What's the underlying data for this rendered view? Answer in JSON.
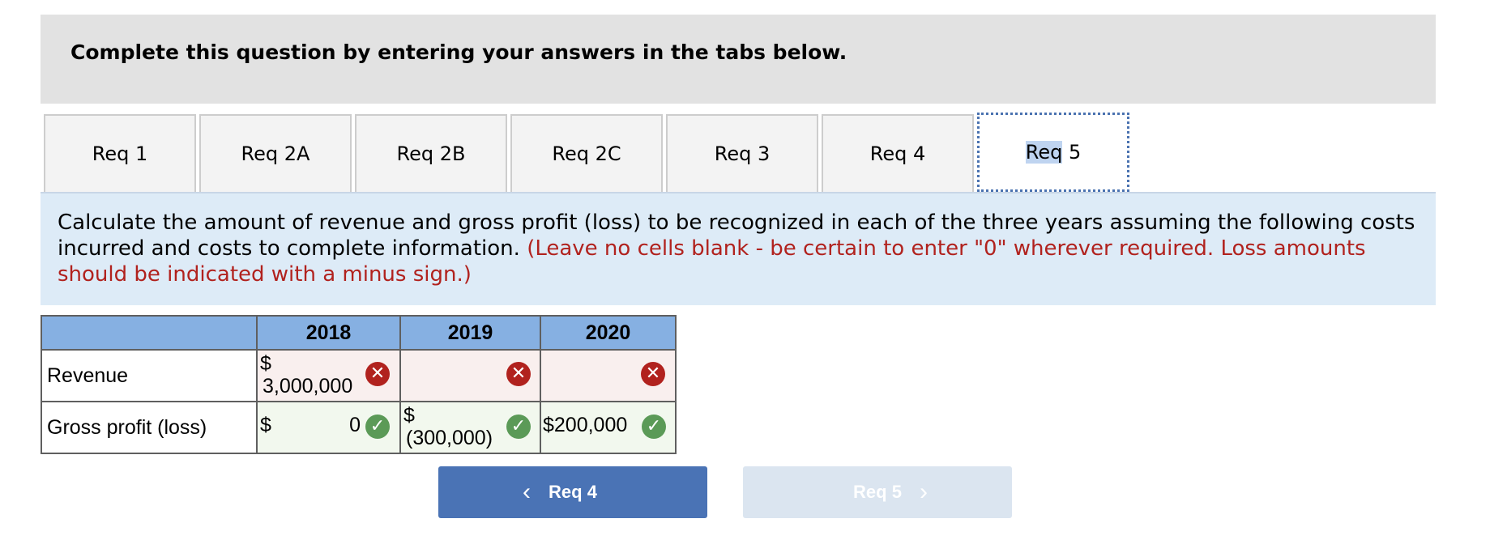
{
  "header": {
    "title": "Complete this question by entering your answers in the tabs below."
  },
  "tabs": [
    {
      "label": "Req 1"
    },
    {
      "label": "Req 2A"
    },
    {
      "label": "Req 2B"
    },
    {
      "label": "Req 2C"
    },
    {
      "label": "Req 3"
    },
    {
      "label": "Req 4"
    },
    {
      "label_selected": "Req",
      "label_rest": " 5"
    }
  ],
  "instructions": {
    "text": "Calculate the amount of revenue and gross profit (loss) to be recognized in each of the three years assuming the following costs incurred and costs to complete information.",
    "note": "(Leave no cells blank - be certain to enter \"0\" wherever required. Loss amounts should be indicated with a minus sign.)"
  },
  "table": {
    "columns": [
      "2018",
      "2019",
      "2020"
    ],
    "rows": [
      {
        "label": "Revenue",
        "cells": [
          {
            "prefix": "$",
            "value": "3,000,000",
            "status": "incorrect"
          },
          {
            "prefix": "",
            "value": "",
            "status": "incorrect"
          },
          {
            "prefix": "",
            "value": "",
            "status": "incorrect"
          }
        ]
      },
      {
        "label": "Gross profit (loss)",
        "cells": [
          {
            "prefix": "$",
            "value": "0",
            "status": "correct"
          },
          {
            "prefix": "$",
            "value": "(300,000)",
            "status": "correct"
          },
          {
            "prefix": "",
            "value": "$200,000",
            "status": "correct"
          }
        ]
      }
    ]
  },
  "nav": {
    "prev_label": "Req 4",
    "next_label": "Req 5"
  },
  "colors": {
    "accent": "#4a73b5",
    "incorrect": "#b1221e",
    "correct": "#5b9a57",
    "header_bg": "#86b0e2"
  }
}
